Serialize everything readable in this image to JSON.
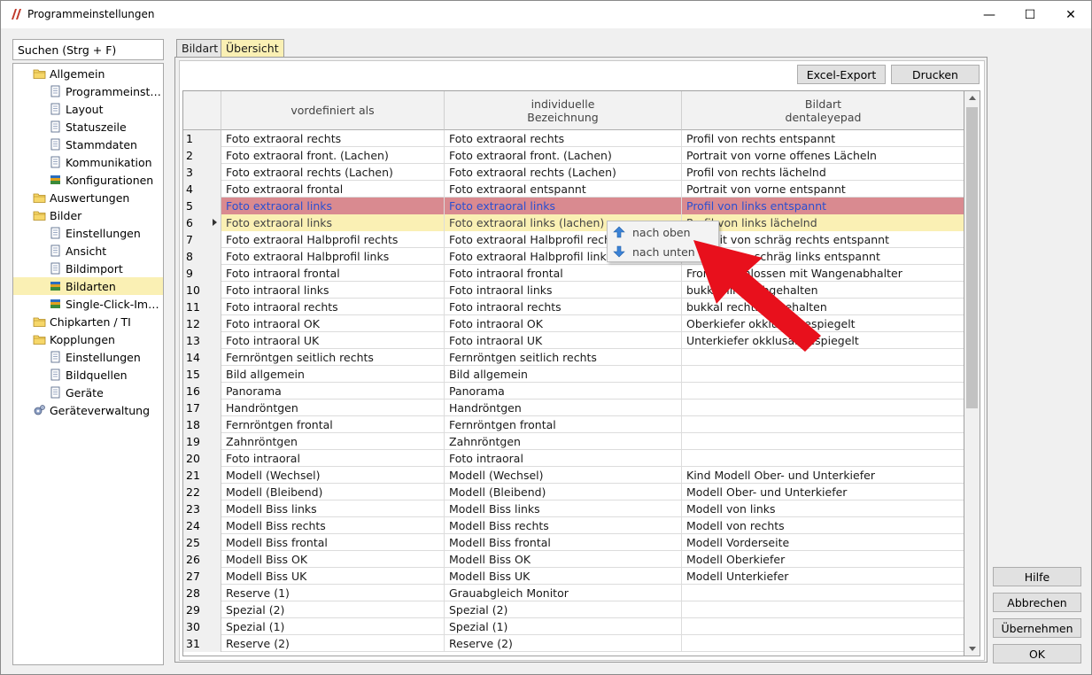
{
  "window": {
    "title": "Programmeinstellungen",
    "controls": {
      "minimize": "—",
      "maximize": "☐",
      "close": "✕"
    }
  },
  "search": {
    "placeholder": "Suchen (Strg + F)"
  },
  "tree": [
    {
      "label": "Allgemein",
      "icon": "folder-icon",
      "level": 0
    },
    {
      "label": "Programmeinst…",
      "icon": "page-icon",
      "level": 1
    },
    {
      "label": "Layout",
      "icon": "page-icon",
      "level": 1
    },
    {
      "label": "Statuszeile",
      "icon": "page-icon",
      "level": 1
    },
    {
      "label": "Stammdaten",
      "icon": "page-icon",
      "level": 1
    },
    {
      "label": "Kommunikation",
      "icon": "page-icon",
      "level": 1
    },
    {
      "label": "Konfigurationen",
      "icon": "stack-icon",
      "level": 1
    },
    {
      "label": "Auswertungen",
      "icon": "folder-icon",
      "level": 0
    },
    {
      "label": "Bilder",
      "icon": "folder-icon",
      "level": 0
    },
    {
      "label": "Einstellungen",
      "icon": "page-icon",
      "level": 1
    },
    {
      "label": "Ansicht",
      "icon": "page-icon",
      "level": 1
    },
    {
      "label": "Bildimport",
      "icon": "page-icon",
      "level": 1
    },
    {
      "label": "Bildarten",
      "icon": "stack-icon",
      "level": 1,
      "selected": true
    },
    {
      "label": "Single-Click-Im…",
      "icon": "stack-icon",
      "level": 1
    },
    {
      "label": "Chipkarten / TI",
      "icon": "folder-icon",
      "level": 0
    },
    {
      "label": "Kopplungen",
      "icon": "folder-icon",
      "level": 0
    },
    {
      "label": "Einstellungen",
      "icon": "page-icon",
      "level": 1
    },
    {
      "label": "Bildquellen",
      "icon": "page-icon",
      "level": 1
    },
    {
      "label": "Geräte",
      "icon": "page-icon",
      "level": 1
    },
    {
      "label": "Geräteverwaltung",
      "icon": "gear-icon",
      "level": 0
    }
  ],
  "tabs": [
    {
      "label": "Bildart",
      "active": false
    },
    {
      "label": "Übersicht",
      "active": true
    }
  ],
  "toolbar": {
    "excel": "Excel-Export",
    "print": "Drucken"
  },
  "grid": {
    "headers": [
      "vordefiniert als",
      "individuelle\nBezeichnung",
      "Bildart\ndentaleyepad"
    ],
    "rows": [
      [
        "1",
        "Foto extraoral rechts",
        "Foto extraoral rechts",
        "Profil von rechts entspannt"
      ],
      [
        "2",
        "Foto extraoral front. (Lachen)",
        "Foto extraoral front. (Lachen)",
        "Portrait von vorne offenes Lächeln"
      ],
      [
        "3",
        "Foto extraoral rechts (Lachen)",
        "Foto extraoral rechts (Lachen)",
        "Profil von rechts lächelnd"
      ],
      [
        "4",
        "Foto extraoral frontal",
        "Foto extraoral entspannt",
        "Portrait von vorne entspannt"
      ],
      [
        "5",
        "Foto extraoral links",
        "Foto extraoral links",
        "Profil von links entspannt"
      ],
      [
        "6",
        "Foto extraoral links",
        "Foto extraoral links (lachen)",
        "Profil von links lächelnd"
      ],
      [
        "7",
        "Foto extraoral Halbprofil rechts",
        "Foto extraoral Halbprofil rechts",
        "Portrait von schräg rechts entspannt"
      ],
      [
        "8",
        "Foto extraoral Halbprofil links",
        "Foto extraoral Halbprofil links",
        "Portrait von schräg links entspannt"
      ],
      [
        "9",
        "Foto intraoral frontal",
        "Foto intraoral frontal",
        "Front geschlossen mit Wangenabhalter"
      ],
      [
        "10",
        "Foto intraoral links",
        "Foto intraoral links",
        "bukkal links abgehalten"
      ],
      [
        "11",
        "Foto intraoral rechts",
        "Foto intraoral rechts",
        "bukkal rechts abgehalten"
      ],
      [
        "12",
        "Foto intraoral OK",
        "Foto intraoral OK",
        "Oberkiefer okklusal gespiegelt"
      ],
      [
        "13",
        "Foto intraoral UK",
        "Foto intraoral UK",
        "Unterkiefer okklusal gespiegelt"
      ],
      [
        "14",
        "Fernröntgen seitlich rechts",
        "Fernröntgen seitlich rechts",
        ""
      ],
      [
        "15",
        "Bild allgemein",
        "Bild allgemein",
        ""
      ],
      [
        "16",
        "Panorama",
        "Panorama",
        ""
      ],
      [
        "17",
        "Handröntgen",
        "Handröntgen",
        ""
      ],
      [
        "18",
        "Fernröntgen frontal",
        "Fernröntgen frontal",
        ""
      ],
      [
        "19",
        "Zahnröntgen",
        "Zahnröntgen",
        ""
      ],
      [
        "20",
        "Foto intraoral",
        "Foto intraoral",
        ""
      ],
      [
        "21",
        "Modell (Wechsel)",
        "Modell (Wechsel)",
        "Kind Modell Ober- und Unterkiefer"
      ],
      [
        "22",
        "Modell (Bleibend)",
        "Modell (Bleibend)",
        "Modell Ober- und Unterkiefer"
      ],
      [
        "23",
        "Modell Biss links",
        "Modell Biss links",
        "Modell von links"
      ],
      [
        "24",
        "Modell Biss rechts",
        "Modell Biss rechts",
        "Modell von rechts"
      ],
      [
        "25",
        "Modell Biss frontal",
        "Modell Biss frontal",
        "Modell Vorderseite"
      ],
      [
        "26",
        "Modell Biss OK",
        "Modell Biss OK",
        "Modell Oberkiefer"
      ],
      [
        "27",
        "Modell Biss UK",
        "Modell Biss UK",
        "Modell Unterkiefer"
      ],
      [
        "28",
        "Reserve (1)",
        "Grauabgleich Monitor",
        ""
      ],
      [
        "29",
        "Spezial (2)",
        "Spezial (2)",
        ""
      ],
      [
        "30",
        "Spezial (1)",
        "Spezial (1)",
        ""
      ],
      [
        "31",
        "Reserve (2)",
        "Reserve (2)",
        ""
      ]
    ]
  },
  "context_menu": {
    "up": "nach oben",
    "down": "nach unten"
  },
  "buttons": {
    "help": "Hilfe",
    "cancel": "Abbrechen",
    "apply": "Übernehmen",
    "ok": "OK"
  },
  "colors": {
    "selected_row": "#d98a90",
    "current_row": "#faf0b4",
    "selected_text": "#2a4fd0",
    "annotation_arrow": "#e8101c"
  }
}
